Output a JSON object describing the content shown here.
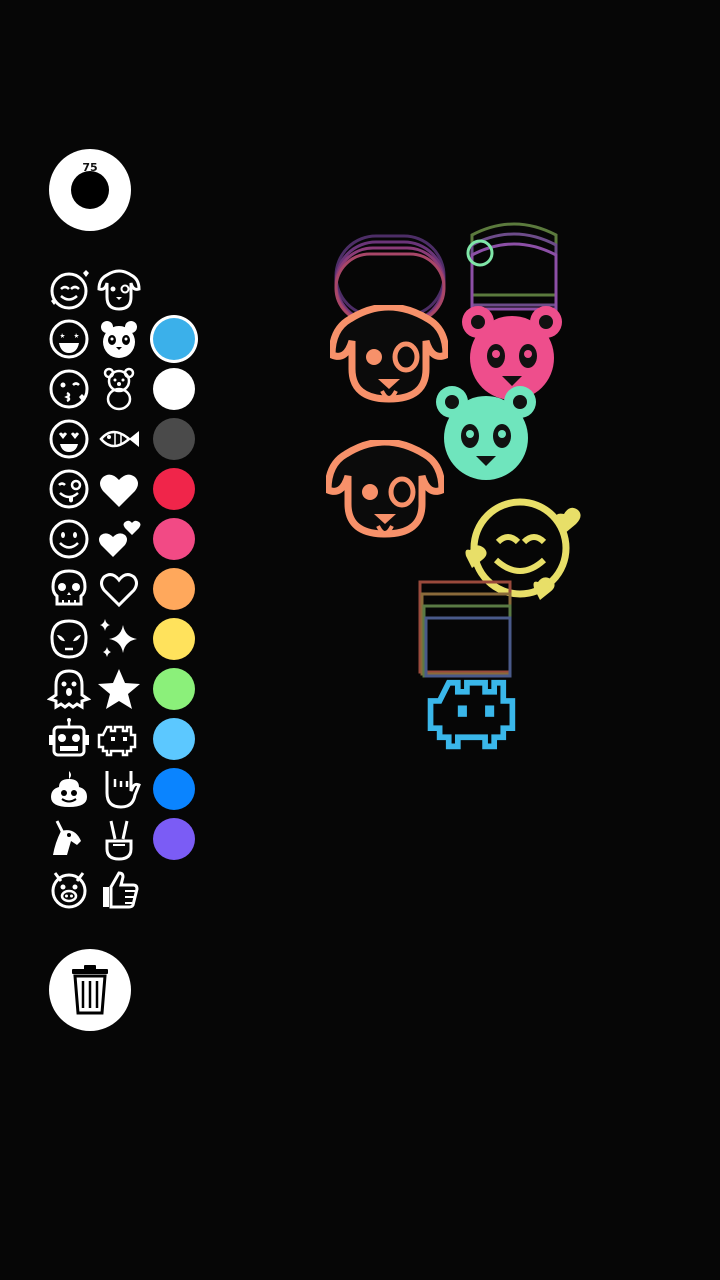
{
  "brush": {
    "size_value": "75"
  },
  "stickers": {
    "left_column": [
      "smiling-hearts",
      "star-eyes",
      "kiss",
      "heart-eyes",
      "winking-tongue",
      "smile",
      "skull",
      "alien",
      "ghost",
      "robot",
      "poop",
      "unicorn",
      "pig"
    ],
    "right_column": [
      "dog",
      "panda",
      "teddy-bear",
      "fish",
      "heart-filled",
      "two-hearts",
      "heart-outline",
      "sparkles",
      "star",
      "space-invader",
      "rock-hand",
      "peace-hand",
      "thumbs-up"
    ]
  },
  "colors": [
    {
      "name": "sky-blue",
      "hex": "#3BB0EA",
      "selected": true
    },
    {
      "name": "white",
      "hex": "#FFFFFF"
    },
    {
      "name": "dark-gray",
      "hex": "#4A4A4A"
    },
    {
      "name": "red",
      "hex": "#F0254A"
    },
    {
      "name": "pink",
      "hex": "#F24A85"
    },
    {
      "name": "orange",
      "hex": "#FFA85C"
    },
    {
      "name": "yellow",
      "hex": "#FFE25C"
    },
    {
      "name": "green",
      "hex": "#8BF07A"
    },
    {
      "name": "light-blue",
      "hex": "#5CC8FF"
    },
    {
      "name": "blue",
      "hex": "#0A84FF"
    },
    {
      "name": "purple",
      "hex": "#7B5CF5"
    }
  ],
  "canvas": {
    "placed_stickers": [
      {
        "kind": "dog",
        "color": "#F7916A"
      },
      {
        "kind": "panda",
        "color": "#EE4E8C"
      },
      {
        "kind": "panda",
        "color": "#6FE5BD"
      },
      {
        "kind": "dog",
        "color": "#F7916A"
      },
      {
        "kind": "smiling-hearts",
        "color": "#E8DF68"
      },
      {
        "kind": "space-invader",
        "color": "#3AB7EA"
      }
    ]
  }
}
